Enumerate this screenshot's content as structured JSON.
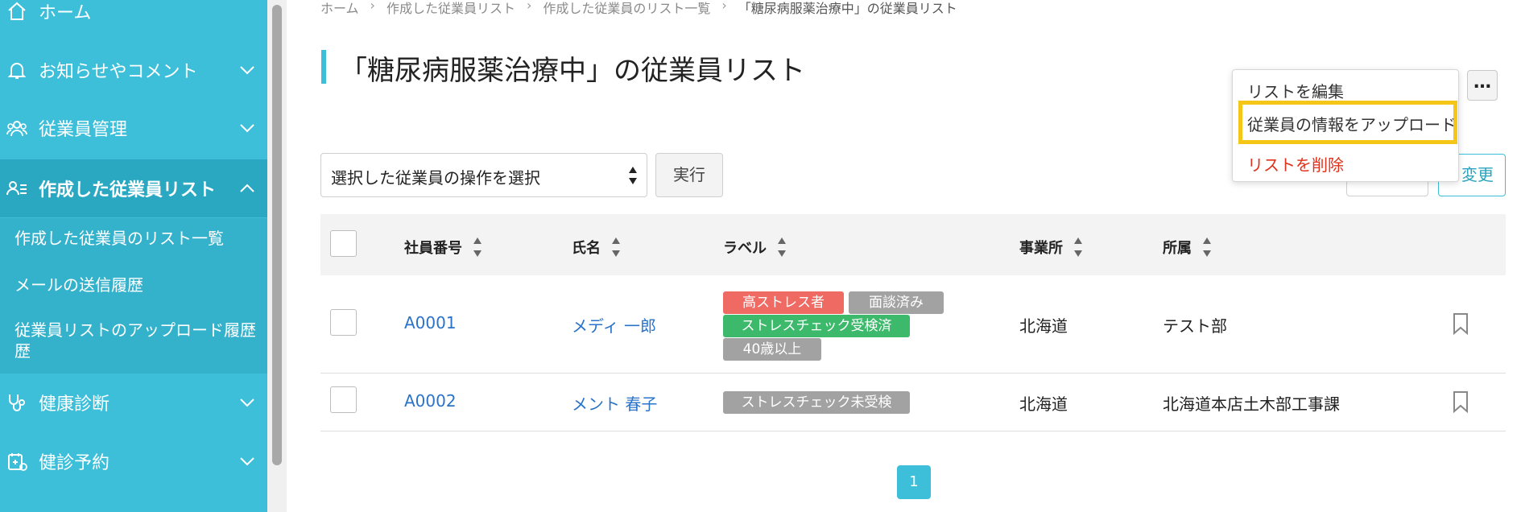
{
  "sidebar": {
    "items": [
      {
        "label": "ホーム",
        "icon": "home-icon"
      },
      {
        "label": "お知らせやコメント",
        "icon": "bell-icon"
      },
      {
        "label": "従業員管理",
        "icon": "users-icon"
      },
      {
        "label": "作成した従業員リスト",
        "icon": "user-list-icon"
      },
      {
        "label": "健康診断",
        "icon": "stethoscope-icon"
      },
      {
        "label": "健診予約",
        "icon": "calendar-medical-icon"
      }
    ],
    "sub_items": [
      "作成した従業員のリスト一覧",
      "メールの送信履歴",
      "従業員リストのアップロード履歴"
    ],
    "sub_items_wrap": "歴"
  },
  "breadcrumb": {
    "items": [
      "ホーム",
      "作成した従業員リスト",
      "作成した従業員のリスト一覧"
    ],
    "current": "「糖尿病服薬治療中」の従業員リスト",
    "separator": "›"
  },
  "page": {
    "title": "「糖尿病服薬治療中」の従業員リスト"
  },
  "actions": {
    "select_placeholder": "選択した従業員の操作を選択",
    "exec_label": "実行",
    "change_label_partial": "変更",
    "more_label": "…"
  },
  "dropdown": {
    "items": [
      {
        "label": "リストを編集",
        "danger": false
      },
      {
        "label": "従業員の情報をアップロード",
        "danger": false,
        "highlighted": true
      },
      {
        "label": "リストを削除",
        "danger": true
      }
    ]
  },
  "table": {
    "headers": [
      "社員番号",
      "氏名",
      "ラベル",
      "事業所",
      "所属"
    ],
    "rows": [
      {
        "id": "A0001",
        "name": "メディ 一郎",
        "labels": [
          {
            "text": "高ストレス者",
            "color": "red"
          },
          {
            "text": "面談済み",
            "color": "gray"
          },
          {
            "text": "ストレスチェック受検済",
            "color": "green"
          },
          {
            "text": "40歳以上",
            "color": "gray"
          }
        ],
        "office": "北海道",
        "department": "テスト部"
      },
      {
        "id": "A0002",
        "name": "メント 春子",
        "labels": [
          {
            "text": "ストレスチェック未受検",
            "color": "gray"
          }
        ],
        "office": "北海道",
        "department": "北海道本店土木部工事課"
      }
    ]
  },
  "pagination": {
    "current": "1"
  },
  "colors": {
    "accent": "#3dbfda",
    "link": "#2a73c8",
    "danger": "#e0311a",
    "highlight": "#f5c518"
  }
}
